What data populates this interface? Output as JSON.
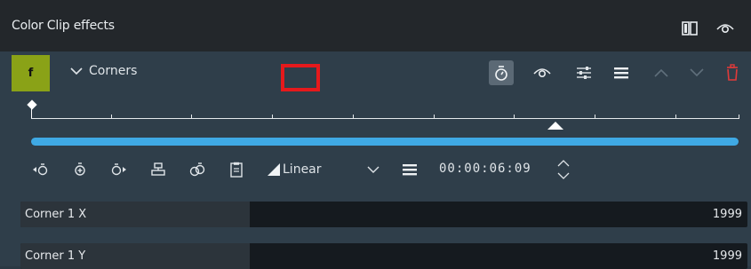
{
  "panel": {
    "title": "Color Clip effects"
  },
  "effect": {
    "badge": "f",
    "name": "Corners"
  },
  "keyframes": {
    "interpolation": "Linear",
    "timecode": "00:00:06:09",
    "playhead_fraction": 0.74
  },
  "params": [
    {
      "label": "Corner 1 X",
      "value": "1999",
      "fill_fraction": 0.316
    },
    {
      "label": "Corner 1 Y",
      "value": "1999",
      "fill_fraction": 0.316
    }
  ],
  "colors": {
    "badge_bg": "#8aa217",
    "progress": "#3fa9e4",
    "highlight_box": "#e6191c",
    "delete_icon": "#e03a3a"
  },
  "icons": {
    "titlebar": [
      "compare-split-icon",
      "eye-icon"
    ],
    "header": [
      "keyframe-stopwatch-icon",
      "eye-icon",
      "sliders-icon",
      "menu-icon",
      "move-up-icon",
      "move-down-icon",
      "delete-icon"
    ],
    "toolbar": [
      "prev-keyframe-icon",
      "add-keyframe-icon",
      "next-keyframe-icon",
      "align-icon",
      "copy-keyframe-icon",
      "clipboard-icon",
      "linear-interpolation-icon",
      "dropdown-chevron-icon",
      "menu-icon",
      "spin-icon"
    ]
  }
}
